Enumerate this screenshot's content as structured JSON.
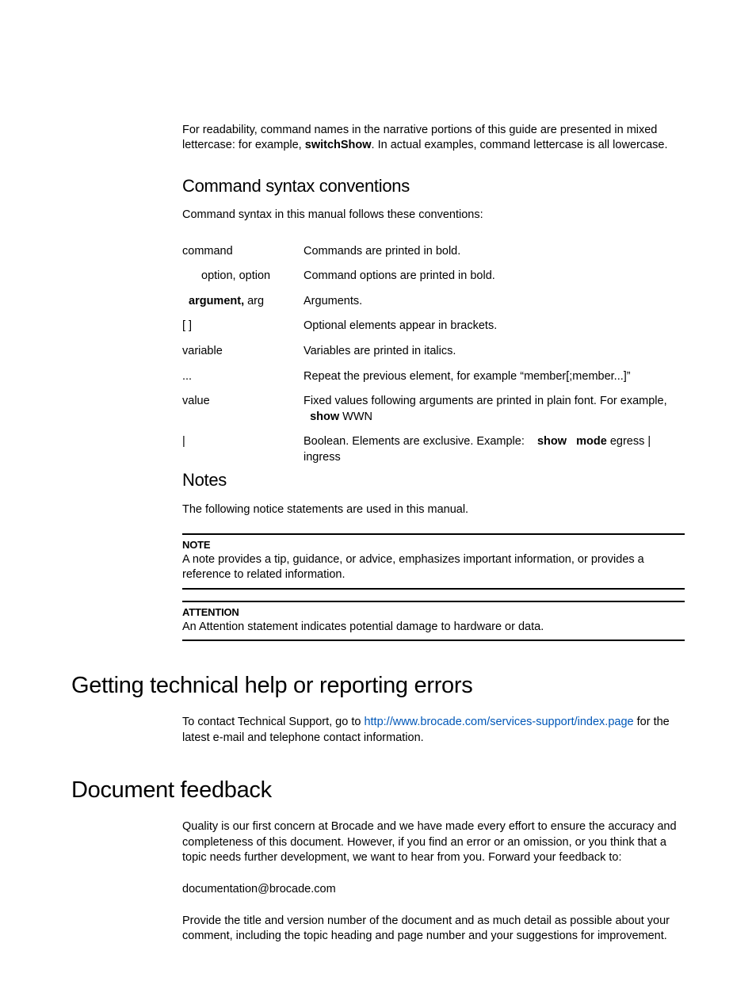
{
  "intro": {
    "text_before": "For readability, command names in the narrative portions of this guide are presented in mixed lettercase: for example, ",
    "bold_cmd": "switchShow",
    "text_after": ". In actual examples, command lettercase is all lowercase."
  },
  "syntax_section": {
    "heading": "Command syntax conventions",
    "lead": "Command syntax in this manual follows these conventions:",
    "rows": {
      "r0_l": "command",
      "r0_d": "Commands are printed in bold.",
      "r1_l": "option, option",
      "r1_d": "Command options are printed in bold.",
      "r2_l_bold": "argument,",
      "r2_l_rest": " arg",
      "r2_d": "Arguments.",
      "r3_l": "[ ]",
      "r3_d": "Optional elements appear in brackets.",
      "r4_l": "variable",
      "r4_d": "Variables are printed in italics.",
      "r5_l": "...",
      "r5_d": "Repeat the previous element, for example “member[;member...]”",
      "r6_l": "value",
      "r6_d_before": "Fixed values following arguments are printed in plain font. For example, ",
      "r6_d_bold": "show",
      "r6_d_after": " WWN",
      "r7_l": "|",
      "r7_d_before": "Boolean. Elements are exclusive. Example:    ",
      "r7_d_bold": "show   mode",
      "r7_d_after": " egress | ingress"
    }
  },
  "notes_section": {
    "heading": "Notes",
    "lead": "The following notice statements are used in this manual.",
    "note_label": "NOTE",
    "note_text": "A note provides a tip, guidance, or advice, emphasizes important information, or provides a reference to related information.",
    "attention_label": "ATTENTION",
    "attention_text": "An Attention statement indicates potential damage to hardware or data."
  },
  "help_section": {
    "heading": "Getting technical help or reporting errors",
    "text_before": "To contact Technical Support, go to ",
    "link_text": "http://www.brocade.com/services-support/index.page",
    "text_after": " for the latest e-mail and telephone contact information."
  },
  "feedback_section": {
    "heading": "Document feedback",
    "p1": "Quality is our first concern at Brocade and we have made every effort to ensure the accuracy and completeness of this document. However, if you find an error or an omission, or you think that a topic needs further development, we want to hear from you. Forward your feedback to:",
    "email": "documentation@brocade.com",
    "p2": "Provide the title and version number of the document and as much detail as possible about your comment, including the topic heading and page number and your suggestions for improvement."
  }
}
